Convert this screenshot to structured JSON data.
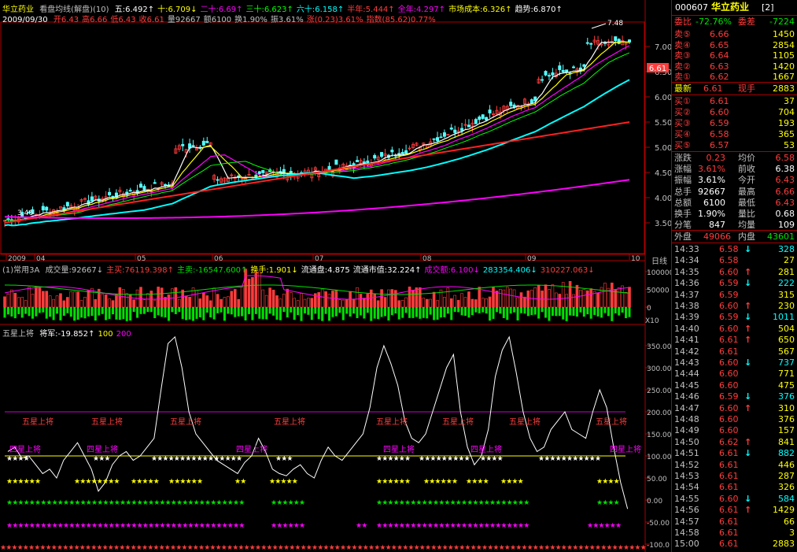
{
  "header": {
    "stock_name": "华立药业",
    "indicator_name": "看盘均线(解盘)(10)",
    "ma": [
      {
        "label": "五:6.492",
        "color": "#ffffff",
        "arrow": "↑"
      },
      {
        "label": "十:6.709",
        "color": "#ffff00",
        "arrow": "↓"
      },
      {
        "label": "二十:6.69",
        "color": "#ff00ff",
        "arrow": "↑"
      },
      {
        "label": "三十:6.623",
        "color": "#00ff00",
        "arrow": "↑"
      },
      {
        "label": "六十:6.158",
        "color": "#00ffff",
        "arrow": "↑"
      },
      {
        "label": "半年:5.444",
        "color": "#ff3c3c",
        "arrow": "↑"
      },
      {
        "label": "全年:4.297",
        "color": "#ff00ff",
        "arrow": "↑"
      },
      {
        "label": "市场成本:6.326",
        "color": "#ffff00",
        "arrow": "↑"
      },
      {
        "label": "趋势:6.870",
        "color": "#ffffff",
        "arrow": "↑"
      }
    ],
    "date": "2009/09/30",
    "quote": [
      {
        "label": "开6.43",
        "color": "#ff3c3c"
      },
      {
        "label": "高6.66",
        "color": "#ff3c3c"
      },
      {
        "label": "低6.43",
        "color": "#ff3c3c"
      },
      {
        "label": "收6.61",
        "color": "#ff3c3c"
      },
      {
        "label": "量92667",
        "color": "#c0c0c0"
      },
      {
        "label": "额6100",
        "color": "#c0c0c0"
      },
      {
        "label": "换1.90%",
        "color": "#c0c0c0"
      },
      {
        "label": "振3.61%",
        "color": "#c0c0c0"
      },
      {
        "label": "涨(0.23)3.61%",
        "color": "#ff3c3c"
      },
      {
        "label": "指数(85.62)0.77%",
        "color": "#ff3c3c"
      }
    ]
  },
  "price_chart": {
    "y_ticks": [
      "7.00",
      "6.50",
      "6.00",
      "5.50",
      "5.00",
      "4.50",
      "4.00",
      "3.50"
    ],
    "high_label": "7.48",
    "current_price": "6.61",
    "low_label": "3.46",
    "x_labels": [
      "2009",
      "04",
      "05",
      "06",
      "07",
      "08",
      "09",
      "10"
    ],
    "period_label": "日线"
  },
  "volume_panel": {
    "title": "(1)常用3A",
    "items": [
      {
        "label": "成交量:92667",
        "color": "#c0c0c0",
        "arrow": "↓"
      },
      {
        "label": "主买:76119.398",
        "color": "#ff3c3c",
        "arrow": "↑"
      },
      {
        "label": "主卖:-16547.600",
        "color": "#00e000",
        "arrow": "↑"
      },
      {
        "label": "换手:1.901",
        "color": "#ffff00",
        "arrow": "↓"
      },
      {
        "label": "流通盘:4.875",
        "color": "#ffffff",
        "arrow": ""
      },
      {
        "label": "流通市值:32.224",
        "color": "#ffffff",
        "arrow": "↑"
      },
      {
        "label": "成交额:6.100",
        "color": "#ff00ff",
        "arrow": "↓"
      },
      {
        "label": "283354.406",
        "color": "#00ffff",
        "arrow": "↓"
      },
      {
        "label": "310227.063",
        "color": "#ff3c3c",
        "arrow": "↓"
      }
    ],
    "y_ticks": [
      "100000",
      "50000",
      "0"
    ],
    "unit": "X10"
  },
  "indicator_panel": {
    "title": "五星上将",
    "items": [
      {
        "label": "将军:-19.852",
        "color": "#ffffff",
        "arrow": "↑"
      },
      {
        "label": "100",
        "color": "#ffff00",
        "arrow": ""
      },
      {
        "label": "200",
        "color": "#ff00ff",
        "arrow": ""
      }
    ],
    "y_ticks": [
      "350.00",
      "300.00",
      "250.00",
      "200.00",
      "150.00",
      "100.00",
      "50.00",
      "0.00",
      "-50.00",
      "-100.0"
    ],
    "five_star_label": "五星上将",
    "four_star_label": "四星上将"
  },
  "right_panel": {
    "code": "000607",
    "name": "华立药业",
    "suffix": "[2]",
    "weibi_label": "委比",
    "weibi_value": "-72.76%",
    "weicha_label": "委差",
    "weicha_value": "-7224",
    "sell": [
      {
        "label": "卖⑤",
        "price": "6.66",
        "vol": "1450"
      },
      {
        "label": "卖④",
        "price": "6.65",
        "vol": "2854"
      },
      {
        "label": "卖③",
        "price": "6.64",
        "vol": "1105"
      },
      {
        "label": "卖②",
        "price": "6.63",
        "vol": "1420"
      },
      {
        "label": "卖①",
        "price": "6.62",
        "vol": "1667"
      }
    ],
    "latest_label": "最新",
    "latest_value": "6.61",
    "xianshou_label": "现手",
    "xianshou_value": "2883",
    "buy": [
      {
        "label": "买①",
        "price": "6.61",
        "vol": "37"
      },
      {
        "label": "买②",
        "price": "6.60",
        "vol": "704"
      },
      {
        "label": "买③",
        "price": "6.59",
        "vol": "193"
      },
      {
        "label": "买④",
        "price": "6.58",
        "vol": "365"
      },
      {
        "label": "买⑤",
        "price": "6.57",
        "vol": "53"
      }
    ],
    "stats": [
      {
        "l1": "涨跌",
        "v1": "0.23",
        "c1": "#ff3c3c",
        "l2": "均价",
        "v2": "6.58",
        "c2": "#ff3c3c"
      },
      {
        "l1": "涨幅",
        "v1": "3.61%",
        "c1": "#ff3c3c",
        "l2": "前收",
        "v2": "6.38",
        "c2": "#ffffff"
      },
      {
        "l1": "振幅",
        "v1": "3.61%",
        "c1": "#ffffff",
        "l2": "今开",
        "v2": "6.43",
        "c2": "#ff3c3c"
      },
      {
        "l1": "总手",
        "v1": "92667",
        "c1": "#ffffff",
        "l2": "最高",
        "v2": "6.66",
        "c2": "#ff3c3c"
      },
      {
        "l1": "总额",
        "v1": "6100",
        "c1": "#ffffff",
        "l2": "最低",
        "v2": "6.43",
        "c2": "#ff3c3c"
      },
      {
        "l1": "换手",
        "v1": "1.90%",
        "c1": "#ffffff",
        "l2": "量比",
        "v2": "0.68",
        "c2": "#ffffff"
      },
      {
        "l1": "分笔",
        "v1": "847",
        "c1": "#ffffff",
        "l2": "均量",
        "v2": "109",
        "c2": "#ffffff"
      }
    ],
    "waipan_label": "外盘",
    "waipan_value": "49066",
    "neipan_label": "内盘",
    "neipan_value": "43601",
    "ticks": [
      {
        "time": "14:33",
        "price": "6.58",
        "dir": "down",
        "vol": "328"
      },
      {
        "time": "14:34",
        "price": "6.58",
        "dir": "",
        "vol": "27"
      },
      {
        "time": "14:35",
        "price": "6.60",
        "dir": "up",
        "vol": "281"
      },
      {
        "time": "14:36",
        "price": "6.59",
        "dir": "down",
        "vol": "222"
      },
      {
        "time": "14:37",
        "price": "6.59",
        "dir": "",
        "vol": "315"
      },
      {
        "time": "14:38",
        "price": "6.60",
        "dir": "up",
        "vol": "230"
      },
      {
        "time": "14:39",
        "price": "6.59",
        "dir": "down",
        "vol": "1011"
      },
      {
        "time": "14:40",
        "price": "6.60",
        "dir": "up",
        "vol": "504"
      },
      {
        "time": "14:41",
        "price": "6.61",
        "dir": "up",
        "vol": "650"
      },
      {
        "time": "14:42",
        "price": "6.61",
        "dir": "",
        "vol": "567"
      },
      {
        "time": "14:43",
        "price": "6.60",
        "dir": "down",
        "vol": "737"
      },
      {
        "time": "14:44",
        "price": "6.60",
        "dir": "",
        "vol": "771"
      },
      {
        "time": "14:45",
        "price": "6.60",
        "dir": "",
        "vol": "475"
      },
      {
        "time": "14:46",
        "price": "6.59",
        "dir": "down",
        "vol": "376"
      },
      {
        "time": "14:47",
        "price": "6.60",
        "dir": "up",
        "vol": "310"
      },
      {
        "time": "14:48",
        "price": "6.60",
        "dir": "",
        "vol": "376"
      },
      {
        "time": "14:49",
        "price": "6.60",
        "dir": "",
        "vol": "157"
      },
      {
        "time": "14:50",
        "price": "6.62",
        "dir": "up",
        "vol": "841"
      },
      {
        "time": "14:51",
        "price": "6.61",
        "dir": "down",
        "vol": "882"
      },
      {
        "time": "14:52",
        "price": "6.61",
        "dir": "",
        "vol": "446"
      },
      {
        "time": "14:53",
        "price": "6.61",
        "dir": "",
        "vol": "287"
      },
      {
        "time": "14:54",
        "price": "6.61",
        "dir": "",
        "vol": "326"
      },
      {
        "time": "14:55",
        "price": "6.60",
        "dir": "down",
        "vol": "584"
      },
      {
        "time": "14:56",
        "price": "6.61",
        "dir": "up",
        "vol": "1429"
      },
      {
        "time": "14:57",
        "price": "6.61",
        "dir": "",
        "vol": "66"
      },
      {
        "time": "14:58",
        "price": "6.61",
        "dir": "",
        "vol": "3"
      },
      {
        "time": "15:00",
        "price": "6.61",
        "dir": "",
        "vol": "2883"
      }
    ]
  }
}
